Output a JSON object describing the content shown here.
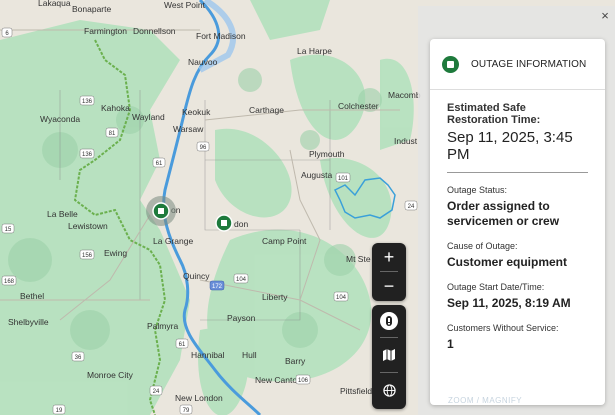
{
  "map": {
    "places": [
      "Bonaparte",
      "West Point",
      "Farmington",
      "Donnellson",
      "Fort Madison",
      "La Harpe",
      "Nauvoo",
      "Kahoka",
      "Wyaconda",
      "Wayland",
      "Keokuk",
      "Warsaw",
      "Carthage",
      "Colchester",
      "Macomb",
      "Plymouth",
      "Indust",
      "Augusta",
      "La Belle",
      "Lewistown",
      "La Grange",
      "Ewing",
      "Camp Point",
      "Mt Ste",
      "Quincy",
      "Bethel",
      "Liberty",
      "Shelbyville",
      "Payson",
      "Palmyra",
      "Hannibal",
      "Hull",
      "Barry",
      "Monroe City",
      "New Canton",
      "Pittsfield",
      "New London",
      "Lakaqua",
      "on",
      "don"
    ],
    "routes": [
      "136",
      "81",
      "136",
      "61",
      "96",
      "101",
      "6",
      "15",
      "24",
      "156",
      "104",
      "172",
      "168",
      "104",
      "36",
      "61",
      "106",
      "24",
      "19",
      "79"
    ]
  },
  "controls": {
    "zoom_in": "+",
    "zoom_out": "−",
    "layer_icon": "alert-marker-icon",
    "map_icon": "map-icon",
    "globe_icon": "globe-icon"
  },
  "panel": {
    "close": "×",
    "title": "OUTAGE INFORMATION",
    "restoration_label": "Estimated Safe Restoration Time:",
    "restoration_value": "Sep 11, 2025, 3:45 PM",
    "status_label": "Outage Status:",
    "status_value": "Order assigned to servicemen or crew",
    "cause_label": "Cause of Outage:",
    "cause_value": "Customer equipment",
    "start_label": "Outage Start Date/Time:",
    "start_value": "Sep 11, 2025, 8:19 AM",
    "customers_label": "Customers Without Service:",
    "customers_value": "1",
    "zoom_label": "ZOOM / MAGNIFY"
  },
  "colors": {
    "land": "#eae6dd",
    "forest": "#a9dcb4",
    "water": "#9dc7ee",
    "river": "#4a9bdc",
    "outage_green": "#1e7a3c",
    "boundary_green": "#6bb04e",
    "boundary_blue": "#3aa0d9"
  }
}
